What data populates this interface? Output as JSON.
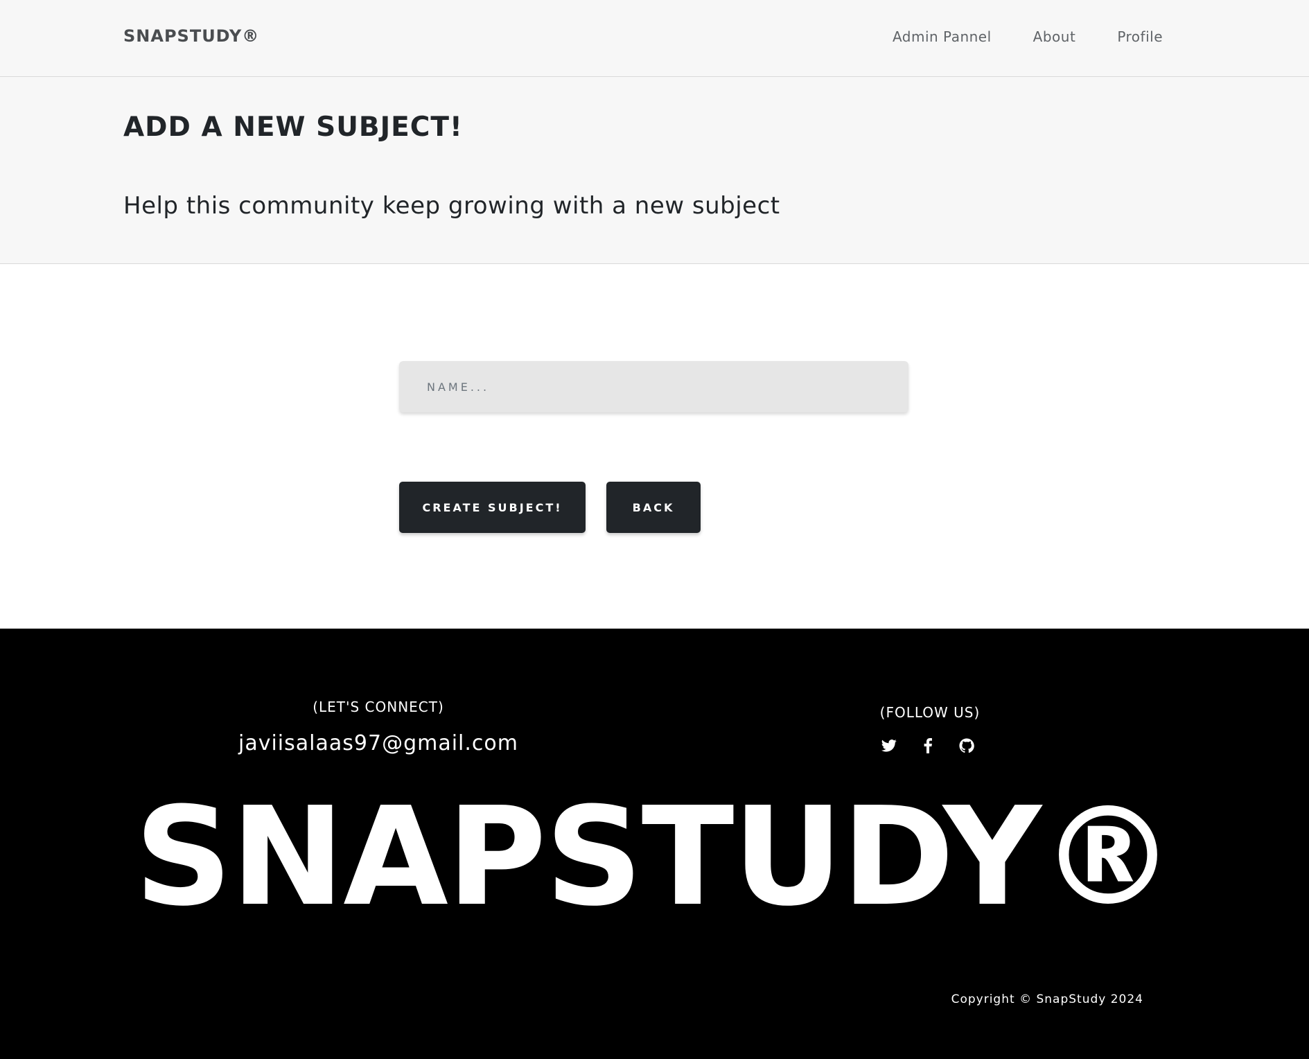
{
  "navbar": {
    "brand": "SNAPSTUDY®",
    "links": [
      {
        "label": "Admin Pannel"
      },
      {
        "label": "About"
      },
      {
        "label": "Profile"
      }
    ]
  },
  "hero": {
    "title": "ADD A NEW SUBJECT!",
    "subtitle": "Help this community keep growing with a new subject"
  },
  "form": {
    "name_placeholder": "NAME...",
    "name_value": "",
    "create_label": "CREATE SUBJECT!",
    "back_label": "BACK"
  },
  "footer": {
    "connect_label": "(LET'S CONNECT)",
    "email": "javiisalaas97@gmail.com",
    "follow_label": "(FOLLOW US)",
    "social_icons": [
      "twitter-icon",
      "facebook-icon",
      "github-icon"
    ],
    "big_logo": "SNAPSTUDY®",
    "copyright": "Copyright © SnapStudy 2024"
  },
  "colors": {
    "header_bg": "#f7f7f7",
    "button_bg": "#212529",
    "input_bg": "#e6e6e6",
    "footer_bg": "#000000"
  }
}
